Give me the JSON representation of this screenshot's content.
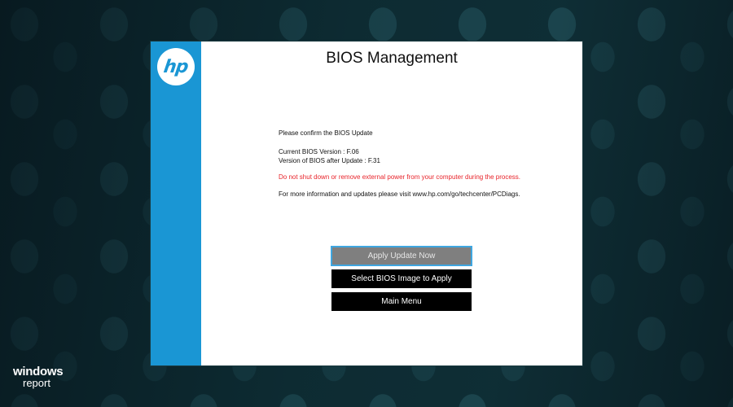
{
  "window": {
    "title": "BIOS Management",
    "logo_text": "hp"
  },
  "content": {
    "confirm": "Please confirm the BIOS Update",
    "current_version": "Current BIOS Version : F.06",
    "after_version": "Version of BIOS after Update : F.31",
    "warning": "Do not shut down or remove external power from your computer during the process.",
    "more_info": "For more information and updates please visit www.hp.com/go/techcenter/PCDiags."
  },
  "buttons": {
    "apply": "Apply Update Now",
    "select": "Select BIOS  Image to Apply",
    "main_menu": "Main Menu"
  },
  "watermark": {
    "line1": "windows",
    "line2": "report"
  },
  "colors": {
    "sidebar": "#1a96d4",
    "warning": "#e8232a",
    "focus_border": "#3fa6e0",
    "disabled_button": "#7f7f7f",
    "button": "#000000"
  },
  "icons": {
    "logo": "hp-logo-icon"
  }
}
